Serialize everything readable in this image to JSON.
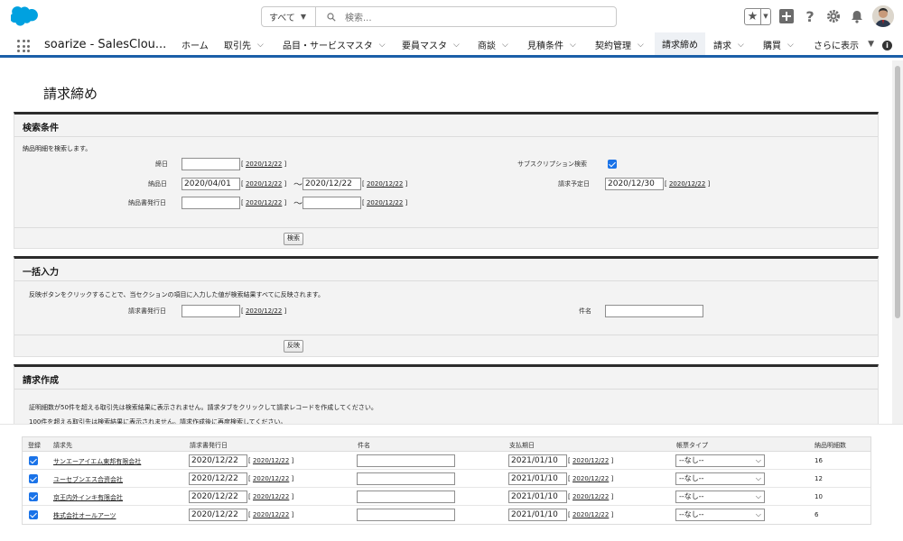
{
  "topbar": {
    "search_scope": "すべて",
    "search_placeholder": "検索..."
  },
  "nav": {
    "app_name": "soarize - SalesClou...",
    "tabs": [
      {
        "label": "ホーム",
        "has_menu": false
      },
      {
        "label": "取引先",
        "has_menu": true
      },
      {
        "label": "品目・サービスマスタ",
        "has_menu": true
      },
      {
        "label": "要員マスタ",
        "has_menu": true
      },
      {
        "label": "商談",
        "has_menu": true
      },
      {
        "label": "見積条件",
        "has_menu": true
      },
      {
        "label": "契約管理",
        "has_menu": true
      },
      {
        "label": "請求締め",
        "has_menu": false,
        "active": true
      },
      {
        "label": "請求",
        "has_menu": true
      },
      {
        "label": "購買",
        "has_menu": true
      },
      {
        "label": "さらに表示",
        "has_menu": true
      }
    ]
  },
  "page": {
    "title": "請求締め"
  },
  "search_section": {
    "title": "検索条件",
    "description": "納品明細を検索します。",
    "closing_date_label": "締日",
    "closing_date_value": "",
    "closing_date_link": "2020/12/22",
    "delivery_date_label": "納品日",
    "delivery_from": "2020/04/01",
    "delivery_from_link": "2020/12/22",
    "delivery_to": "2020/12/22",
    "delivery_to_link": "2020/12/22",
    "issue_date_label": "納品書発行日",
    "issue_from": "",
    "issue_from_link": "2020/12/22",
    "issue_to": "",
    "issue_to_link": "2020/12/22",
    "subscription_label": "サブスクリプション検索",
    "subscription_checked": true,
    "planned_date_label": "請求予定日",
    "planned_date_value": "2020/12/30",
    "planned_date_link": "2020/12/22",
    "search_button": "検索"
  },
  "bulk_section": {
    "title": "一括入力",
    "description": "反映ボタンをクリックすることで、当セクションの項目に入力した値が検索結果すべてに反映されます。",
    "issue_date_label": "請求書発行日",
    "issue_date_value": "",
    "issue_date_link": "2020/12/22",
    "subject_label": "件名",
    "subject_value": "",
    "apply_button": "反映"
  },
  "create_section": {
    "title": "請求作成",
    "note1": "証明細数が50件を超える取引先は検索結果に表示されません。請求タブをクリックして請求レコードを作成してください。",
    "note2": "100件を超える取引先は検索結果に表示されません。請求作成後に再度検索してください。"
  },
  "table": {
    "headers": [
      "登録",
      "請求先",
      "請求書発行日",
      "件名",
      "支払期日",
      "帳票タイプ",
      "納品明細数"
    ],
    "rows": [
      {
        "checked": true,
        "account": "サンエーアイエム東邦有限会社",
        "issue_date": "2020/12/22",
        "issue_link": "2020/12/22",
        "subject": "",
        "due_date": "2021/01/10",
        "due_link": "2020/12/22",
        "form_type": "--なし--",
        "count": "16"
      },
      {
        "checked": true,
        "account": "ユーセブンエス合资会社",
        "issue_date": "2020/12/22",
        "issue_link": "2020/12/22",
        "subject": "",
        "due_date": "2021/01/10",
        "due_link": "2020/12/22",
        "form_type": "--なし--",
        "count": "12"
      },
      {
        "checked": true,
        "account": "京王内外インキ有限会社",
        "issue_date": "2020/12/22",
        "issue_link": "2020/12/22",
        "subject": "",
        "due_date": "2021/01/10",
        "due_link": "2020/12/22",
        "form_type": "--なし--",
        "count": "10"
      },
      {
        "checked": true,
        "account": "株式会社オールアーツ",
        "issue_date": "2020/12/22",
        "issue_link": "2020/12/22",
        "subject": "",
        "due_date": "2021/01/10",
        "due_link": "2020/12/22",
        "form_type": "--なし--",
        "count": "6"
      }
    ]
  },
  "colors": {
    "accent": "#1b5fa8",
    "logo": "#00a1e0",
    "checkbox": "#1a73e8",
    "section_border": "#2c2c2c",
    "section_bg": "#f3f3f3"
  }
}
